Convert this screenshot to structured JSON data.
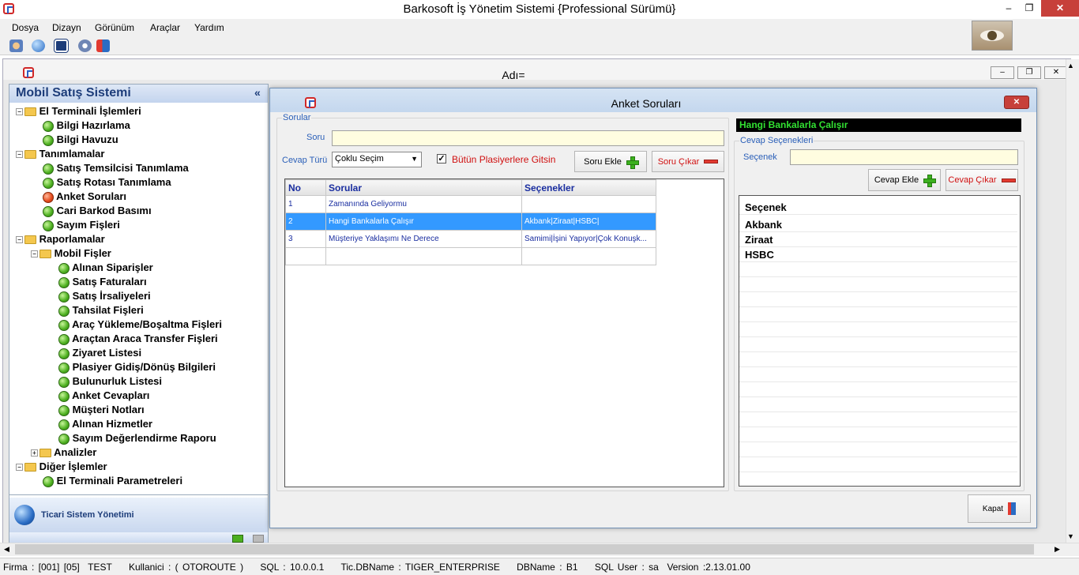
{
  "app": {
    "title": "Barkosoft İş Yönetim Sistemi {Professional Sürümü}"
  },
  "window_controls": {
    "minimize": "–",
    "restore": "❐",
    "close": "✕"
  },
  "menu": [
    {
      "label": "Dosya"
    },
    {
      "label": "Dizayn"
    },
    {
      "label": "Görünüm"
    },
    {
      "label": "Araçlar"
    },
    {
      "label": "Yardım"
    }
  ],
  "toolbar": {
    "icons": [
      "users-icon",
      "globe-icon",
      "report-icon",
      "settings-icon",
      "exit-icon"
    ]
  },
  "mdi": {
    "title": "Adı="
  },
  "left_panel": {
    "title": "Mobil Satış Sistemi",
    "collapse": "«",
    "tree": [
      {
        "label": "El Terminali İşlemleri",
        "type": "group"
      },
      {
        "label": "Bilgi Hazırlama",
        "type": "item"
      },
      {
        "label": "Bilgi Havuzu",
        "type": "item"
      },
      {
        "label": "Tanımlamalar",
        "type": "group"
      },
      {
        "label": "Satış Temsilcisi Tanımlama",
        "type": "item"
      },
      {
        "label": "Satış Rotası Tanımlama",
        "type": "item"
      },
      {
        "label": "Anket Soruları",
        "type": "item",
        "active": true
      },
      {
        "label": "Cari Barkod Basımı",
        "type": "item"
      },
      {
        "label": "Sayım Fişleri",
        "type": "item"
      },
      {
        "label": "Raporlamalar",
        "type": "group"
      },
      {
        "label": "Mobil Fişler",
        "type": "folder"
      },
      {
        "label": "Alınan Siparişler",
        "type": "subitem"
      },
      {
        "label": "Satış Faturaları",
        "type": "subitem"
      },
      {
        "label": "Satış İrsaliyeleri",
        "type": "subitem"
      },
      {
        "label": "Tahsilat Fişleri",
        "type": "subitem"
      },
      {
        "label": "Araç Yükleme/Boşaltma Fişleri",
        "type": "subitem"
      },
      {
        "label": "Araçtan Araca Transfer Fişleri",
        "type": "subitem"
      },
      {
        "label": "Ziyaret Listesi",
        "type": "subitem"
      },
      {
        "label": "Plasiyer Gidiş/Dönüş Bilgileri",
        "type": "subitem"
      },
      {
        "label": "Bulunurluk Listesi",
        "type": "subitem"
      },
      {
        "label": "Anket Cevapları",
        "type": "subitem"
      },
      {
        "label": "Müşteri Notları",
        "type": "subitem"
      },
      {
        "label": "Alınan Hizmetler",
        "type": "subitem"
      },
      {
        "label": "Sayım Değerlendirme Raporu",
        "type": "subitem"
      },
      {
        "label": "Analizler",
        "type": "folder-collapsed"
      },
      {
        "label": "Diğer İşlemler",
        "type": "group"
      },
      {
        "label": "El Terminali Parametreleri",
        "type": "item"
      }
    ],
    "footer": "Ticari Sistem Yönetimi"
  },
  "dialog": {
    "title": "Anket Soruları",
    "close": "✕",
    "questions_group": "Sorular",
    "soru_label": "Soru",
    "soru_value": "",
    "cevap_turu_label": "Cevap Türü",
    "cevap_turu_value": "Çoklu Seçim",
    "all_plasiyer_label": "Bütün Plasiyerlere Gitsin",
    "all_plasiyer_checked": "✓",
    "add_question": "Soru Ekle",
    "remove_question": "Soru Çıkar",
    "grid_headers": [
      "No",
      "Sorular",
      "Seçenekler"
    ],
    "rows": [
      {
        "no": "1",
        "soru": "Zamanında Geliyormu",
        "secenekler": ""
      },
      {
        "no": "2",
        "soru": "Hangi Bankalarla Çalışır",
        "secenekler": "Akbank|Ziraat|HSBC|"
      },
      {
        "no": "3",
        "soru": "Müşteriye Yaklaşımı Ne Derece",
        "secenekler": "Samimi|İşini Yapıyor|Çok Konuşk..."
      },
      {
        "no": "",
        "soru": "",
        "secenekler": ""
      }
    ],
    "selected_question": "Hangi Bankalarla Çalışır",
    "answers_group": "Cevap Seçenekleri",
    "secenek_label": "Seçenek",
    "secenek_value": "",
    "add_answer": "Cevap Ekle",
    "remove_answer": "Cevap Çıkar",
    "options_header": "Seçenek",
    "options": [
      "Akbank",
      "Ziraat",
      "HSBC"
    ],
    "close_button": "Kapat"
  },
  "status": {
    "text": "Firma : [001] [05]  TEST    Kullanici : ( OTOROUTE )    SQL : 10.0.0.1    Tic.DBName : TIGER_ENTERPRISE    DBName : B1    SQL User : sa  Version :2.13.01.00"
  },
  "colors": {
    "accent": "#3399ff",
    "answer_title_bg": "#000000",
    "answer_title_fg": "#32e032",
    "close_red": "#c7403a"
  }
}
